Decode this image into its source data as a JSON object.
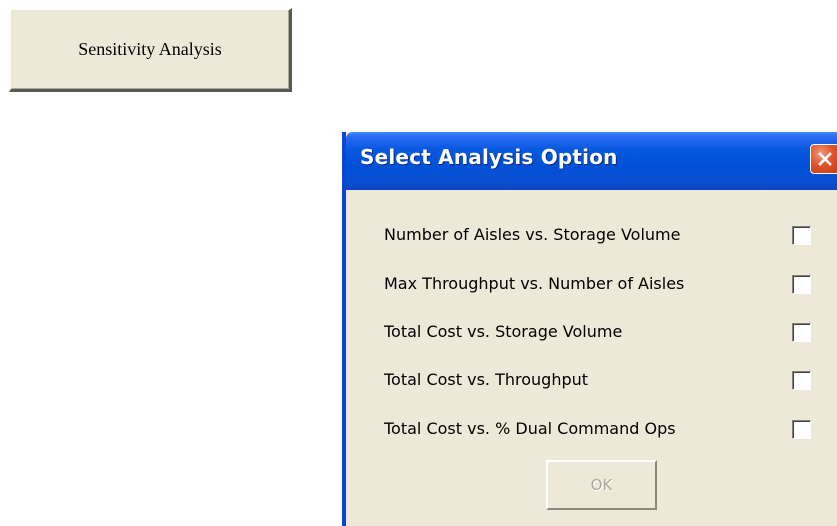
{
  "sheet": {
    "macro_button_label": "Sensitivity Analysis"
  },
  "dialog": {
    "title": "Select Analysis Option",
    "close_icon": "close-x-icon",
    "options": [
      {
        "label": "Number of Aisles vs. Storage Volume",
        "checked": false
      },
      {
        "label": "Max Throughput vs. Number of Aisles",
        "checked": false
      },
      {
        "label": "Total Cost vs. Storage Volume",
        "checked": false
      },
      {
        "label": "Total Cost vs. Throughput",
        "checked": false
      },
      {
        "label": "Total Cost vs. % Dual Command Ops",
        "checked": false
      }
    ],
    "ok_label": "OK",
    "ok_enabled": false
  },
  "colors": {
    "window_face": "#ece9d8",
    "titlebar_blue": "#0858e0",
    "close_red": "#e0542c",
    "disabled_text": "#aca899"
  }
}
